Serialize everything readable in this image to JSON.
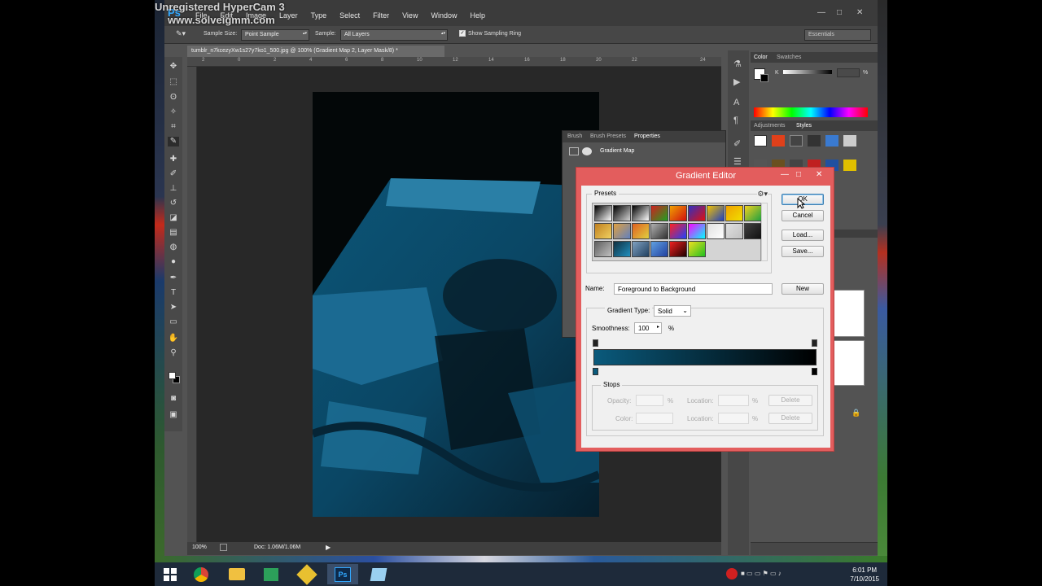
{
  "watermark": {
    "line1": "Unregistered HyperCam 3",
    "line2": "www.solveigmm.com"
  },
  "app": {
    "logo": "Ps",
    "menu": [
      "File",
      "Edit",
      "Image",
      "Layer",
      "Type",
      "Select",
      "Filter",
      "View",
      "Window",
      "Help"
    ],
    "window_controls": {
      "minimize": "—",
      "maximize": "□",
      "close": "✕"
    }
  },
  "options_bar": {
    "sample_size_label": "Sample Size:",
    "sample_size_value": "Point Sample",
    "sample_label": "Sample:",
    "sample_value": "All Layers",
    "show_sampling_ring": "Show Sampling Ring",
    "workspace": "Essentials"
  },
  "document": {
    "tab_title": "tumblr_n7kcezyXw1s27y7ko1_500.jpg @ 100% (Gradient Map 2, Layer Mask/8) *",
    "zoom": "100%",
    "doc_info": "Doc: 1.06M/1.06M",
    "ruler_ticks": [
      "2",
      "0",
      "2",
      "4",
      "6",
      "8",
      "10",
      "12",
      "14",
      "16",
      "18",
      "20",
      "22",
      "24"
    ]
  },
  "properties_panel": {
    "tabs": [
      "Brush",
      "Brush Presets",
      "Properties"
    ],
    "title": "Gradient Map"
  },
  "right_panels": {
    "color_tabs": [
      "Color",
      "Swatches"
    ],
    "adjust_tabs": [
      "Adjustments",
      "Styles"
    ],
    "color_channel": "K",
    "color_unit": "%"
  },
  "gradient_editor": {
    "title": "Gradient Editor",
    "presets_label": "Presets",
    "buttons": {
      "ok": "OK",
      "cancel": "Cancel",
      "load": "Load...",
      "save": "Save...",
      "new": "New"
    },
    "name_label": "Name:",
    "name_value": "Foreground to Background",
    "gradient_type_label": "Gradient Type:",
    "gradient_type_value": "Solid",
    "smoothness_label": "Smoothness:",
    "smoothness_value": "100",
    "smoothness_unit": "%",
    "stops_label": "Stops",
    "opacity_label": "Opacity:",
    "color_label": "Color:",
    "location_label": "Location:",
    "percent": "%",
    "delete_label": "Delete",
    "gradient_colors": [
      "#0a5a7c",
      "#000000"
    ],
    "preset_swatches": [
      [
        "#000",
        "#fff"
      ],
      [
        "#000",
        "rgba(0,0,0,0)"
      ],
      [
        "#000",
        "#fff"
      ],
      [
        "#d02020",
        "#20a020"
      ],
      [
        "#f0a000",
        "#d01010"
      ],
      [
        "#3030c0",
        "#e01010"
      ],
      [
        "#f0c000",
        "#2040c0"
      ],
      [
        "#f0a000",
        "#f0e000"
      ],
      [
        "#f0d020",
        "#20a040"
      ],
      [
        "#c08020",
        "#f0d060"
      ],
      [
        "#e0a040",
        "#6080c0"
      ],
      [
        "#e06020",
        "#e0d040"
      ],
      [
        "#b0b0b0",
        "#303030"
      ],
      [
        "#ff2020",
        "#2040ff"
      ],
      [
        "#ff00ff",
        "#00ffff"
      ],
      [
        "#e0e0e0",
        "#ffffff"
      ],
      [
        "#e0e0e0",
        "#c0c0c0"
      ],
      [
        "#404040",
        "#101010"
      ],
      [
        "#606060",
        "#c0c0c0"
      ],
      [
        "#103040",
        "#2090c0"
      ],
      [
        "#80a0c0",
        "#204060"
      ],
      [
        "#60a0e0",
        "#2040a0"
      ],
      [
        "#f02020",
        "#200000"
      ],
      [
        "#f0e020",
        "#20c020"
      ]
    ]
  },
  "taskbar": {
    "time": "6:01 PM",
    "date": "7/10/2015"
  }
}
